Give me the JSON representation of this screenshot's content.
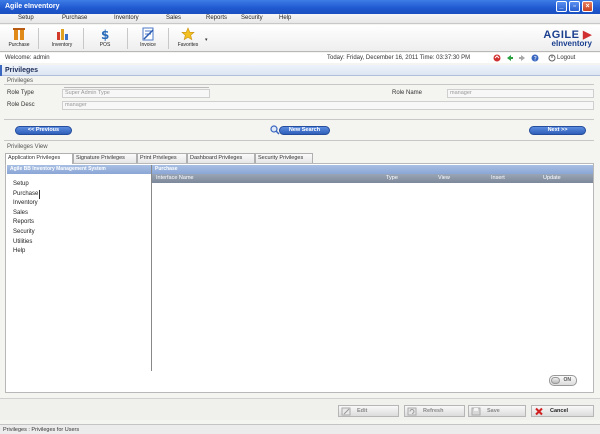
{
  "window": {
    "title": "Agile eInventory"
  },
  "menu": [
    "Setup",
    "Purchase",
    "Inventory",
    "Sales",
    "Reports",
    "Security",
    "Help"
  ],
  "toolbar": {
    "buttons": [
      {
        "label": "Purchase",
        "icon": "purchase-icon"
      },
      {
        "label": "Inventory",
        "icon": "inventory-icon"
      },
      {
        "label": "POS",
        "icon": "pos-icon"
      },
      {
        "label": "Invoice",
        "icon": "invoice-icon"
      },
      {
        "label": "Favorites",
        "icon": "favorites-star-icon"
      }
    ],
    "logo_line1": "AGILE",
    "logo_line2": "eInventory"
  },
  "status": {
    "welcome": "Welcome: admin",
    "datetime": "Today: Friday, December 16, 2011  Time: 03:37:30 PM",
    "logout": "Logout"
  },
  "page": {
    "title": "Privileges"
  },
  "privileges_section": {
    "label": "Privileges",
    "role_type_label": "Role Type",
    "role_type_value": "Super Admin Type",
    "role_desc_label": "Role Desc",
    "role_desc_value": "manager",
    "role_name_label": "Role Name",
    "role_name_value": "manager"
  },
  "nav": {
    "previous": "<< Previous",
    "new_search": "New Search",
    "next": "Next >>"
  },
  "view_section": {
    "label": "Privileges View"
  },
  "tabs": [
    "Application Privileges",
    "Signature Privileges",
    "Print Privileges",
    "Dashboard Privileges",
    "Security Privileges"
  ],
  "left_pane": {
    "header": "Agile BB Inventory Management System",
    "items": [
      "Setup",
      "Purchase",
      "Inventory",
      "Sales",
      "Reports",
      "Security",
      "Utilities",
      "Help"
    ]
  },
  "right_pane": {
    "header": "Purchase",
    "columns": [
      "Interface Name",
      "Type",
      "View",
      "Insert",
      "Update"
    ]
  },
  "toggle": {
    "label": "ON"
  },
  "actions": {
    "edit": "Edit",
    "refresh": "Refresh",
    "save": "Save",
    "cancel": "Cancel"
  },
  "statusbar": {
    "text": "Privileges : Privileges for Users"
  },
  "colors": {
    "titlebar": "#1f58cf",
    "accent": "#2f5fb8",
    "pane_header": "#8aa6d6"
  }
}
